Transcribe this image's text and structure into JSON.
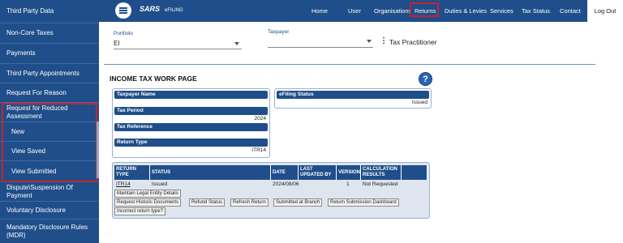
{
  "sidebar": {
    "items": [
      {
        "label": "Third Party Data"
      },
      {
        "label": "Non-Core Taxes"
      },
      {
        "label": "Payments"
      },
      {
        "label": "Third Party Appointments"
      },
      {
        "label": "Request For Reason"
      },
      {
        "label": "Request for Reduced Assessment"
      },
      {
        "label": "New"
      },
      {
        "label": "View Saved"
      },
      {
        "label": "View Submitted"
      },
      {
        "label": "Dispute\\Suspension Of Payment"
      },
      {
        "label": "Voluntary Disclosure"
      },
      {
        "label": "Mandatory Disclosure Rules (MDR)"
      }
    ]
  },
  "header": {
    "logo_text": "SARS",
    "logo_sub": "eFILING",
    "nav": [
      "Home",
      "User",
      "Organisations",
      "Returns",
      "Duties & Levies",
      "Services",
      "Tax Status",
      "Contact"
    ],
    "logout": "Log Out",
    "active_nav": "Returns"
  },
  "selector": {
    "portfolio_label": "Portfolio",
    "portfolio_value": "EI",
    "taxpayer_label": "Taxpayer",
    "taxpayer_value": "",
    "tax_practitioner": "Tax Practitioner"
  },
  "page": {
    "title": "INCOME TAX WORK PAGE",
    "help_icon": "?"
  },
  "details": {
    "taxpayer_name_label": "Taxpayer Name",
    "taxpayer_name_value": "",
    "tax_period_label": "Tax Period",
    "tax_period_value": "2024",
    "tax_reference_label": "Tax Reference",
    "tax_reference_value": "",
    "return_type_label": "Return Type",
    "return_type_value": "ITR14",
    "efiling_status_label": "eFiling Status",
    "efiling_status_value": "Issued"
  },
  "table": {
    "headers": [
      "RETURN TYPE",
      "STATUS",
      "DATE",
      "LAST UPDATED BY",
      "VERSION",
      "CALCULATION RESULTS"
    ],
    "rows": [
      {
        "return_type": "ITR14",
        "status": "Issued",
        "date": "2024/08/06",
        "last_updated_by": "",
        "version": "1",
        "calculation": "Not Requested"
      }
    ]
  },
  "actions": [
    "Maintain Legal Entity Details",
    "Request Historic Documents",
    "Refund Status",
    "Refresh Return",
    "Submitted at Branch",
    "Return Submission Dashboard",
    "Incorrect return type?"
  ],
  "colors": {
    "brand": "#1f4e8a",
    "highlight": "#c1272d",
    "help": "#2b63b5"
  }
}
